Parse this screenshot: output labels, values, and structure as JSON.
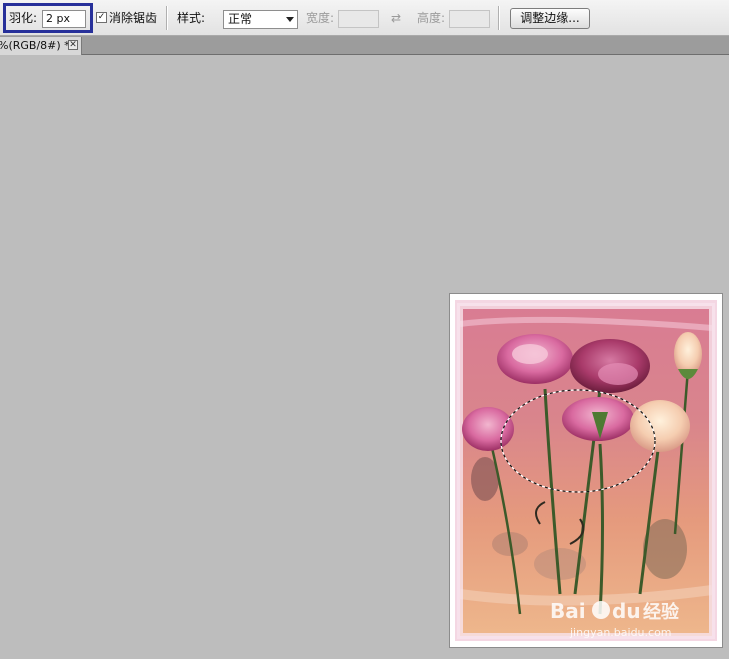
{
  "toolbar": {
    "feather_label": "羽化:",
    "feather_value": "2 px",
    "anti_alias_label": "消除锯齿",
    "anti_alias_checked": true,
    "anti_alias_mark": "✓",
    "style_label": "样式:",
    "style_value": "正常",
    "width_label": "宽度:",
    "height_label": "高度:",
    "swap_icon": "swap-icon",
    "swap_glyph": "⇄",
    "refine_edge_label": "调整边缘..."
  },
  "document_tab": {
    "title": "%(RGB/8#) *",
    "close_glyph": "✕"
  },
  "watermark": {
    "brand": "Bai",
    "brand2": "du",
    "cn": "经验",
    "url": "jingyan.baidu.com"
  },
  "colors": {
    "highlight": "#27309a",
    "workspace": "#bdbdbd"
  }
}
